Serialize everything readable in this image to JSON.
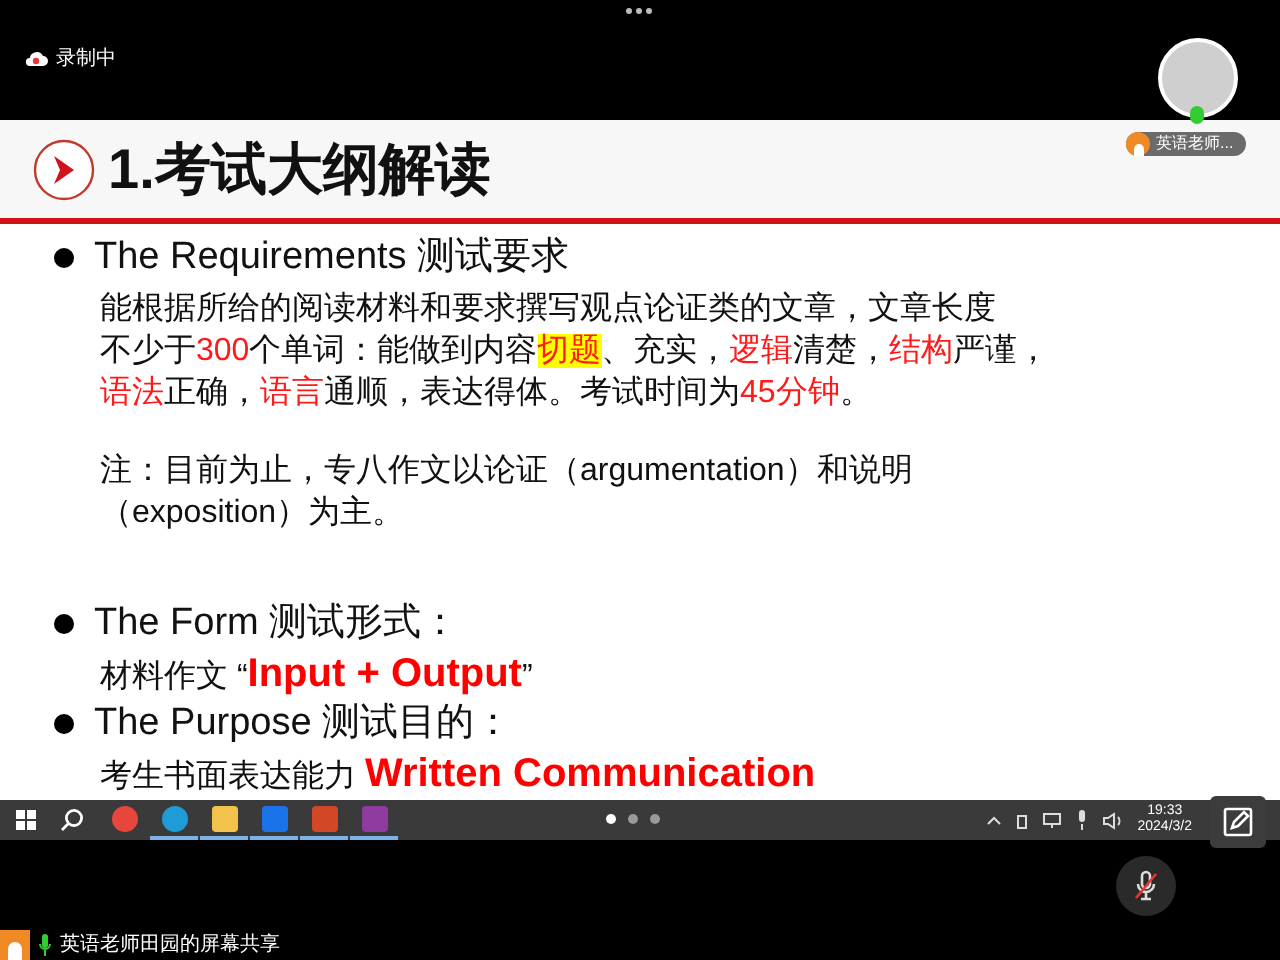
{
  "meeting": {
    "recording_label": "录制中",
    "presenter_tag": "英语老师...",
    "share_label": "英语老师田园的屏幕共享",
    "mic_muted": true
  },
  "slide": {
    "title": "1.考试大纲解读",
    "sections": [
      {
        "heading": "The Requirements 测试要求",
        "paragraphs": [
          {
            "lines": [
              [
                {
                  "kind": "plain",
                  "text": "能根据所给的阅读材料和要求撰写观点论证类的文章，文章长度"
                }
              ],
              [
                {
                  "kind": "plain",
                  "text": "不少于"
                },
                {
                  "kind": "red",
                  "text": "300"
                },
                {
                  "kind": "plain",
                  "text": "个单词：能做到内容"
                },
                {
                  "kind": "highlight",
                  "text": "切题"
                },
                {
                  "kind": "plain",
                  "text": "、充实，"
                },
                {
                  "kind": "red",
                  "text": "逻辑"
                },
                {
                  "kind": "plain",
                  "text": "清楚，"
                },
                {
                  "kind": "red",
                  "text": "结构"
                },
                {
                  "kind": "plain",
                  "text": "严谨，"
                }
              ],
              [
                {
                  "kind": "red",
                  "text": "语法"
                },
                {
                  "kind": "plain",
                  "text": "正确，"
                },
                {
                  "kind": "red",
                  "text": "语言"
                },
                {
                  "kind": "plain",
                  "text": "通顺，表达得体。考试时间为"
                },
                {
                  "kind": "red",
                  "text": "45分钟"
                },
                {
                  "kind": "plain",
                  "text": "。"
                }
              ]
            ]
          },
          {
            "lines": [
              [
                {
                  "kind": "plain",
                  "text": "注：目前为止，专八作文以论证（argumentation）和说明"
                }
              ],
              [
                {
                  "kind": "plain",
                  "text": "（exposition）为主。"
                }
              ]
            ]
          }
        ]
      },
      {
        "heading": "The Form 测试形式：",
        "paragraphs": [
          {
            "lines": [
              [
                {
                  "kind": "plain",
                  "text": "材料作文 “"
                },
                {
                  "kind": "redbold",
                  "text": "Input + Output"
                },
                {
                  "kind": "plain",
                  "text": "”"
                }
              ]
            ]
          }
        ]
      },
      {
        "heading": "The Purpose 测试目的：",
        "paragraphs": [
          {
            "lines": [
              [
                {
                  "kind": "plain",
                  "text": "考生书面表达能力 "
                },
                {
                  "kind": "redbold",
                  "text": "Written Communication"
                }
              ]
            ]
          }
        ]
      }
    ]
  },
  "taskbar": {
    "apps": [
      {
        "kind": "chrome",
        "running": false
      },
      {
        "kind": "edge",
        "running": true
      },
      {
        "kind": "folder",
        "running": true
      },
      {
        "kind": "blue",
        "running": true
      },
      {
        "kind": "powerpoint",
        "running": true
      },
      {
        "kind": "purple",
        "running": true
      }
    ],
    "pages": [
      {
        "selected": true
      },
      {
        "selected": false
      },
      {
        "selected": false
      }
    ],
    "time": "19:33",
    "date": "2024/3/2"
  }
}
